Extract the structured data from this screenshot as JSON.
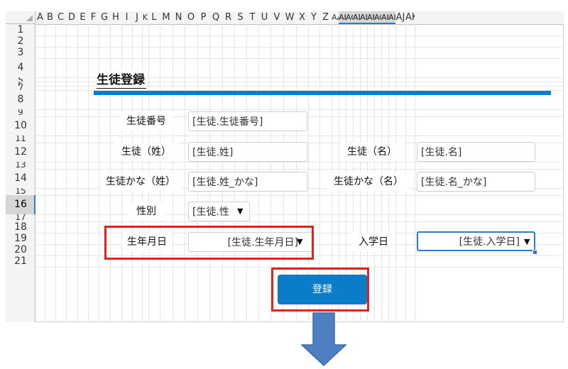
{
  "spreadsheet": {
    "columns": [
      "A",
      "B",
      "C",
      "D",
      "E",
      "F",
      "G",
      "H",
      "I",
      "J",
      "K",
      "L",
      "M",
      "N",
      "O",
      "P",
      "Q",
      "R",
      "S",
      "T",
      "U",
      "V",
      "W",
      "X",
      "Y",
      "Z",
      "AA",
      "AB",
      "AC",
      "AD",
      "AE",
      "AF",
      "AG",
      "AH",
      "AI",
      "AJ",
      "AK"
    ],
    "selected_columns": [
      "AB",
      "AC",
      "AD",
      "AE",
      "AF",
      "AG",
      "AH",
      "AI"
    ],
    "rows": [
      "1",
      "2",
      "3",
      "4",
      "5",
      "6",
      "7",
      "8",
      "9",
      "10",
      "11",
      "12",
      "13",
      "14",
      "15",
      "16",
      "17",
      "18",
      "19",
      "20",
      "21"
    ],
    "selected_row": "16"
  },
  "form": {
    "title": "生徒登録",
    "student_number_label": "生徒番号",
    "student_number_value": "[生徒.生徒番号]",
    "last_name_label": "生徒（姓）",
    "last_name_value": "[生徒.姓]",
    "first_name_label": "生徒（名）",
    "first_name_value": "[生徒.名]",
    "last_name_kana_label": "生徒かな（姓）",
    "last_name_kana_value": "[生徒.姓_かな]",
    "first_name_kana_label": "生徒かな（名）",
    "first_name_kana_value": "[生徒.名_かな]",
    "gender_label": "性別",
    "gender_value": "[生徒.性",
    "birthdate_label": "生年月日",
    "birthdate_value": "[生徒.生年月日]",
    "enrollment_label": "入学日",
    "enrollment_value": "[生徒.入学日]",
    "register_button": "登録",
    "dropdown_caret": "▼"
  },
  "colors": {
    "accent": "#0a7cc8",
    "button": "#0a7cc8",
    "highlight": "#e2221f",
    "selection": "#2b7bd0",
    "arrow": "#4e7fc2"
  },
  "icons": [
    "select-all-corner-icon",
    "dropdown-caret-icon",
    "down-arrow-icon"
  ]
}
